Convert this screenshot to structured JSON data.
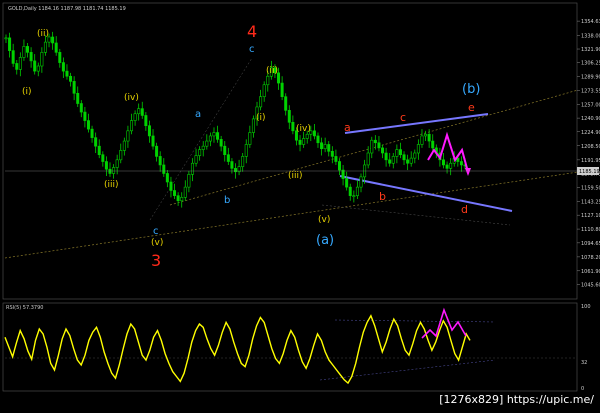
{
  "window": {
    "main_title": "GOLD,Daily  1184.16 1187.98 1181.74 1185.19",
    "rsi_title": "RSI(5) 57.3790",
    "watermark": "[1276x829] https://upic.me/"
  },
  "colors": {
    "background": "#000000",
    "candles": "#00d200",
    "axis_text": "#cfcfcf",
    "wave_minor": "#e6d200",
    "wave_blue": "#36a9ff",
    "wave_red": "#ff3a1a",
    "channel": "#7777ff",
    "pattern": "#ff1aff",
    "rsi_line": "#ffff00"
  },
  "chart_data": [
    {
      "type": "candlestick",
      "title": "GOLD,Daily",
      "ohlc_last": {
        "open": 1184.16,
        "high": 1187.98,
        "low": 1181.74,
        "close": 1185.19
      },
      "ylim": [
        1030,
        1370
      ],
      "price_ticks": [
        1354.63,
        1338.0,
        1321.9,
        1306.25,
        1289.9,
        1273.55,
        1257.0,
        1240.9,
        1224.9,
        1208.5,
        1191.95,
        1175.75,
        1159.5,
        1143.25,
        1127.1,
        1110.8,
        1094.65,
        1078.2,
        1061.9,
        1045.6
      ],
      "current_price_label": "1185.19",
      "close": [
        1335,
        1320,
        1305,
        1298,
        1312,
        1325,
        1318,
        1308,
        1296,
        1302,
        1318,
        1330,
        1336,
        1329,
        1318,
        1306,
        1296,
        1290,
        1284,
        1270,
        1258,
        1248,
        1238,
        1228,
        1218,
        1208,
        1198,
        1190,
        1181,
        1176,
        1183,
        1192,
        1203,
        1214,
        1226,
        1238,
        1246,
        1252,
        1244,
        1232,
        1220,
        1208,
        1196,
        1186,
        1176,
        1166,
        1156,
        1150,
        1144,
        1148,
        1160,
        1175,
        1188,
        1197,
        1204,
        1208,
        1214,
        1220,
        1224,
        1216,
        1208,
        1198,
        1190,
        1182,
        1178,
        1184,
        1196,
        1210,
        1224,
        1240,
        1254,
        1266,
        1280,
        1290,
        1300,
        1294,
        1282,
        1266,
        1250,
        1236,
        1226,
        1215,
        1210,
        1217,
        1222,
        1226,
        1220,
        1212,
        1205,
        1210,
        1202,
        1196,
        1190,
        1180,
        1170,
        1160,
        1150,
        1150,
        1160,
        1172,
        1186,
        1200,
        1215,
        1212,
        1206,
        1200,
        1192,
        1188,
        1196,
        1204,
        1198,
        1192,
        1188,
        1194,
        1200,
        1210,
        1220,
        1222,
        1214,
        1206,
        1200,
        1192,
        1186,
        1182,
        1188,
        1194,
        1190,
        1186,
        1185
      ],
      "wave_labels": [
        {
          "text": "(i)",
          "group": "minor"
        },
        {
          "text": "(ii)",
          "group": "minor"
        },
        {
          "text": "(iii)",
          "group": "minor"
        },
        {
          "text": "(iv)",
          "group": "minor"
        },
        {
          "text": "(v)",
          "group": "minor"
        },
        {
          "text": "a",
          "group": "blue"
        },
        {
          "text": "b",
          "group": "blue"
        },
        {
          "text": "c",
          "group": "blue"
        },
        {
          "text": "c",
          "group": "blue"
        },
        {
          "text": "(ii)",
          "group": "minor"
        },
        {
          "text": "(i)",
          "group": "minor"
        },
        {
          "text": "(iv)",
          "group": "minor"
        },
        {
          "text": "(iii)",
          "group": "minor"
        },
        {
          "text": "(v)",
          "group": "minor"
        },
        {
          "text": "a",
          "group": "red"
        },
        {
          "text": "b",
          "group": "red"
        },
        {
          "text": "c",
          "group": "red"
        },
        {
          "text": "d",
          "group": "red"
        },
        {
          "text": "e",
          "group": "red"
        }
      ],
      "big_labels": [
        {
          "text": "4",
          "group": "red"
        },
        {
          "text": "3",
          "group": "red"
        },
        {
          "text": "(a)",
          "group": "blue"
        },
        {
          "text": "(b)",
          "group": "blue"
        }
      ]
    },
    {
      "type": "line",
      "title": "RSI(5) 57.3790",
      "ylim": [
        0,
        100
      ],
      "ticks": [
        100,
        32,
        0
      ],
      "values": [
        62,
        50,
        38,
        55,
        70,
        60,
        45,
        35,
        58,
        72,
        66,
        50,
        30,
        22,
        40,
        60,
        72,
        64,
        48,
        34,
        28,
        40,
        58,
        68,
        74,
        62,
        44,
        30,
        18,
        12,
        28,
        48,
        66,
        78,
        72,
        56,
        40,
        34,
        46,
        62,
        70,
        58,
        42,
        30,
        20,
        14,
        8,
        18,
        36,
        56,
        70,
        78,
        74,
        60,
        48,
        40,
        52,
        68,
        80,
        72,
        56,
        42,
        30,
        26,
        40,
        60,
        76,
        86,
        80,
        64,
        48,
        36,
        30,
        42,
        58,
        70,
        62,
        46,
        32,
        24,
        36,
        52,
        66,
        58,
        44,
        34,
        28,
        22,
        16,
        10,
        6,
        14,
        30,
        50,
        68,
        80,
        88,
        76,
        60,
        44,
        56,
        72,
        84,
        76,
        60,
        46,
        40,
        54,
        70,
        80,
        72,
        58,
        46,
        56,
        70,
        82,
        74,
        58,
        42,
        34,
        50,
        66,
        58
      ]
    }
  ]
}
